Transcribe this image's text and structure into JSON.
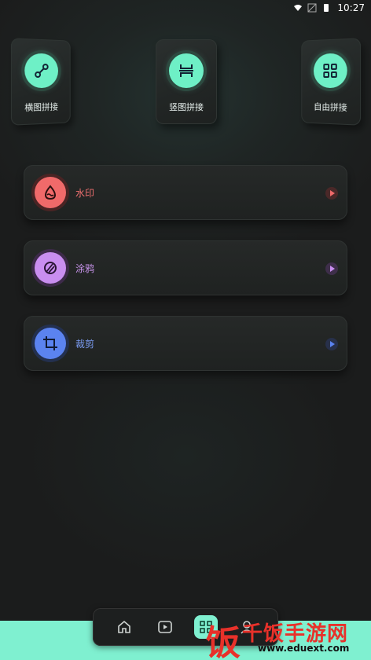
{
  "status_bar": {
    "time": "10:27"
  },
  "tiles": [
    {
      "label": "横图拼接",
      "icon": "link-horizontal-icon"
    },
    {
      "label": "竖图拼接",
      "icon": "split-vertical-icon"
    },
    {
      "label": "自由拼接",
      "icon": "grid-four-icon"
    }
  ],
  "cards": [
    {
      "label": "水印",
      "icon": "watermark-drop-icon",
      "color": "#f06a6a",
      "label_color": "#f07070"
    },
    {
      "label": "涂鸦",
      "icon": "doodle-brush-icon",
      "color": "#c98ef0",
      "label_color": "#c994ec"
    },
    {
      "label": "裁剪",
      "icon": "crop-icon",
      "color": "#5b83f0",
      "label_color": "#7b9cf2"
    }
  ],
  "accent": "#6ef0c6",
  "watermark": {
    "brand": "千饭手游网",
    "url": "www.eduext.com"
  }
}
